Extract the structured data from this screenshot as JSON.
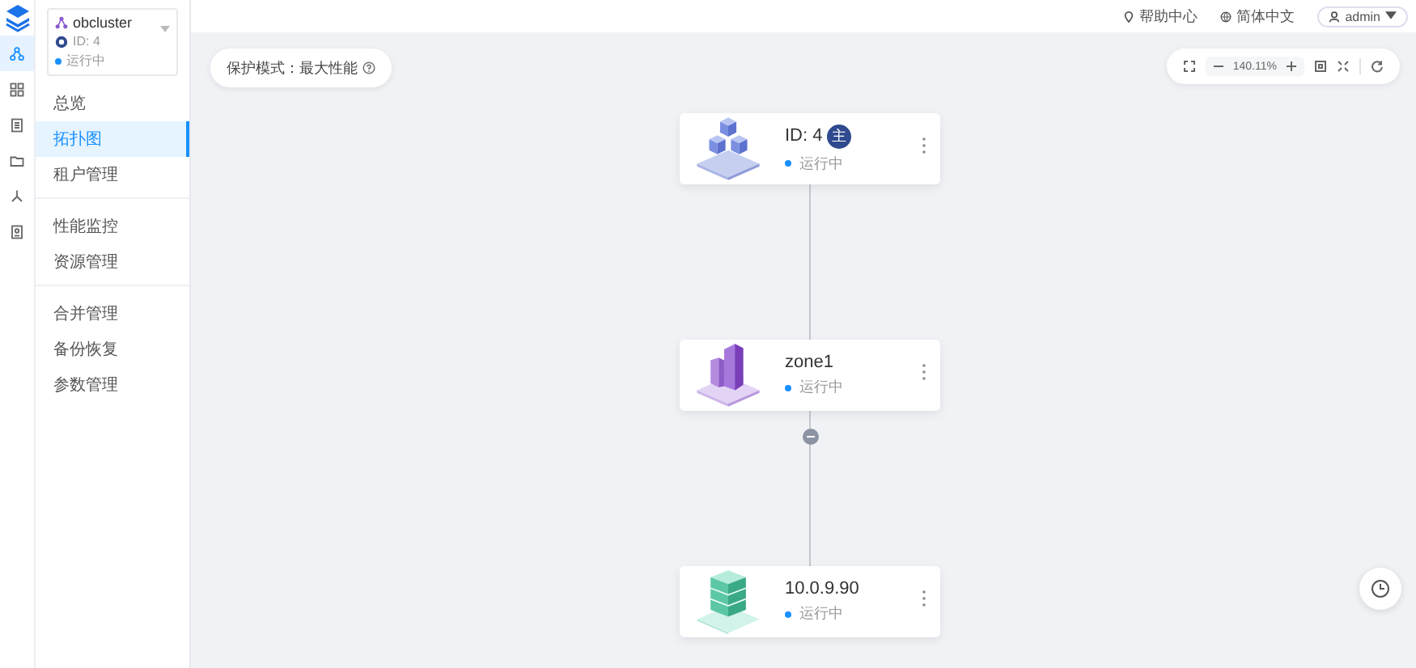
{
  "rail": {
    "items": [
      {
        "kind": "topology",
        "selected": true
      },
      {
        "kind": "grid",
        "selected": false
      },
      {
        "kind": "list",
        "selected": false
      },
      {
        "kind": "folder",
        "selected": false
      },
      {
        "kind": "tree",
        "selected": false
      },
      {
        "kind": "report",
        "selected": false
      }
    ]
  },
  "cluster": {
    "name": "obcluster",
    "id": "ID: 4",
    "status": "运行中"
  },
  "nav": {
    "groups": [
      [
        {
          "label": "总览",
          "selected": false
        },
        {
          "label": "拓扑图",
          "selected": true
        },
        {
          "label": "租户管理",
          "selected": false
        }
      ],
      [
        {
          "label": "性能监控",
          "selected": false
        },
        {
          "label": "资源管理",
          "selected": false
        }
      ],
      [
        {
          "label": "合并管理",
          "selected": false
        },
        {
          "label": "备份恢复",
          "selected": false
        },
        {
          "label": "参数管理",
          "selected": false
        }
      ]
    ]
  },
  "header": {
    "help": "帮助中心",
    "language": "简体中文",
    "user": "admin"
  },
  "protection_mode": "保护模式：最大性能",
  "toolbar": {
    "zoom": "140.11%"
  },
  "nodes": [
    {
      "kind": "cluster",
      "title": "ID: 4",
      "badge": "主",
      "status": "运行中",
      "expanded": false
    },
    {
      "kind": "zone",
      "title": "zone1",
      "status": "运行中",
      "expanded": true
    },
    {
      "kind": "server",
      "title": "10.0.9.90",
      "status": "运行中",
      "expanded": false
    }
  ]
}
